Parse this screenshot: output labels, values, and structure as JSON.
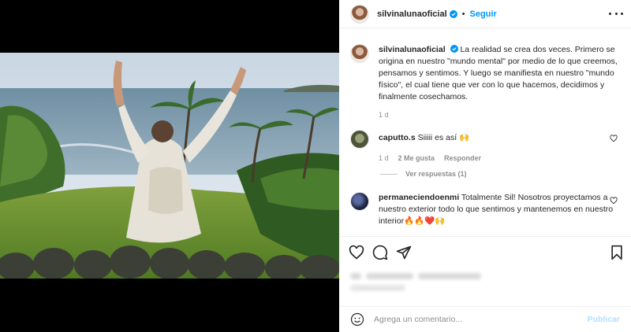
{
  "post": {
    "username": "silvinalunaoficial",
    "separator": "•",
    "follow_label": "Seguir",
    "caption": "La realidad se crea dos veces. Primero se origina en nuestro \"mundo mental\" por medio de lo que creemos, pensamos y sentimos. Y luego se manifiesta en nuestro \"mundo físico\", el cual tiene que ver con lo que hacemos, decidimos y finalmente cosechamos.",
    "caption_time": "1 d"
  },
  "comments": [
    {
      "username": "caputto.s",
      "text": "Siiiii es así 🙌",
      "time": "1 d",
      "likes": "2 Me gusta",
      "reply_label": "Responder",
      "view_replies": "Ver respuestas (1)"
    },
    {
      "username": "permaneciendoenmi",
      "text": "Totalmente Sil! Nosotros proyectamos a nuestro exterior todo lo que sentimos y mantenemos en nuestro interior🔥🔥❤️🙌"
    }
  ],
  "add_comment": {
    "placeholder": "Agrega un comentario...",
    "publish_label": "Publicar"
  },
  "icons": {
    "more": "more-options-icon",
    "like": "heart-icon",
    "comment": "comment-icon",
    "share": "share-icon",
    "save": "bookmark-icon",
    "emoji": "emoji-icon",
    "verified": "verified-badge-icon"
  },
  "colors": {
    "accent": "#0095f6",
    "publish_disabled": "#b2dffc",
    "muted": "#8e8e8e"
  }
}
